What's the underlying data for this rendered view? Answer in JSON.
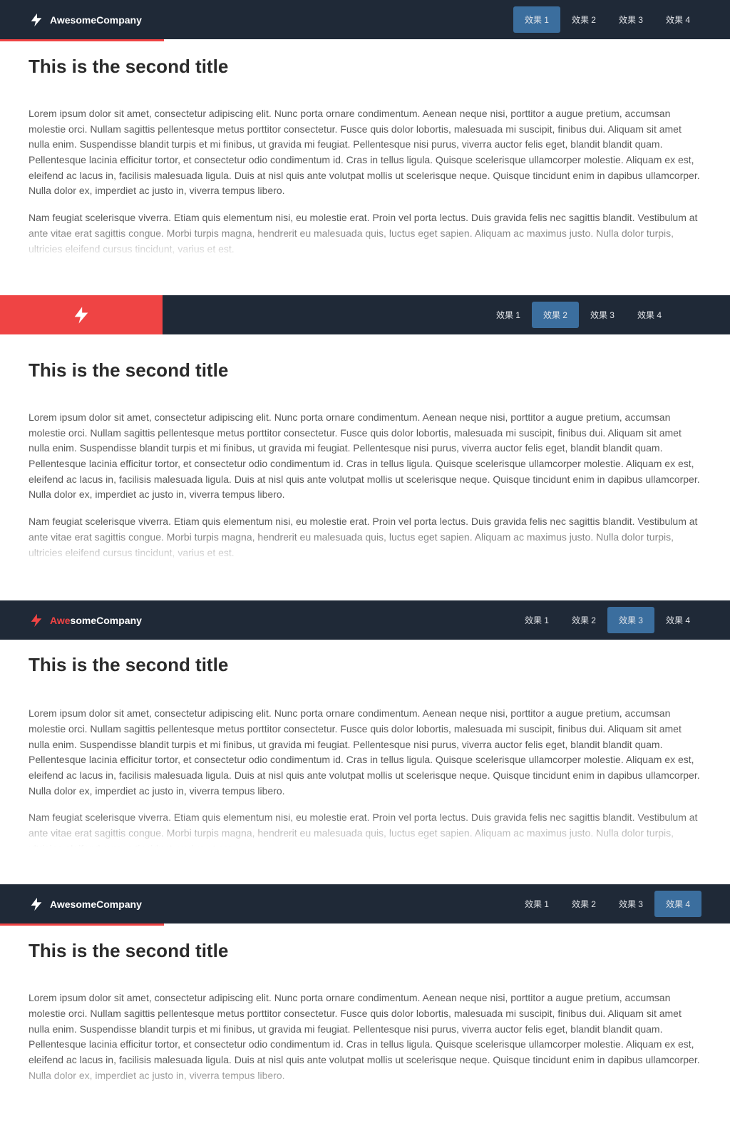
{
  "brand": {
    "name": "AwesomeCompany",
    "prefix": "Awe",
    "suffix": "someCompany"
  },
  "nav": {
    "items": [
      {
        "label": "效果 1"
      },
      {
        "label": "效果 2"
      },
      {
        "label": "效果 3"
      },
      {
        "label": "效果 4"
      }
    ]
  },
  "content": {
    "title": "This is the second title",
    "p1": "Lorem ipsum dolor sit amet, consectetur adipiscing elit. Nunc porta ornare condimentum. Aenean neque nisi, porttitor a augue pretium, accumsan molestie orci. Nullam sagittis pellentesque metus porttitor consectetur. Fusce quis dolor lobortis, malesuada mi suscipit, finibus dui. Aliquam sit amet nulla enim. Suspendisse blandit turpis et mi finibus, ut gravida mi feugiat. Pellentesque nisi purus, viverra auctor felis eget, blandit blandit quam. Pellentesque lacinia efficitur tortor, et consectetur odio condimentum id. Cras in tellus ligula. Quisque scelerisque ullamcorper molestie. Aliquam ex est, eleifend ac lacus in, facilisis malesuada ligula. Duis at nisl quis ante volutpat mollis ut scelerisque neque. Quisque tincidunt enim in dapibus ullamcorper. Nulla dolor ex, imperdiet ac justo in, viverra tempus libero.",
    "p2": "Nam feugiat scelerisque viverra. Etiam quis elementum nisi, eu molestie erat. Proin vel porta lectus. Duis gravida felis nec sagittis blandit. Vestibulum at ante vitae erat sagittis congue. Morbi turpis magna, hendrerit eu malesuada quis, luctus eget sapien. Aliquam ac maximus justo. Nulla dolor turpis, ultricies eleifend cursus tincidunt, varius et est."
  },
  "colors": {
    "navbar": "#1f2937",
    "accent": "#ef4444",
    "active": "#3b6e9e"
  }
}
